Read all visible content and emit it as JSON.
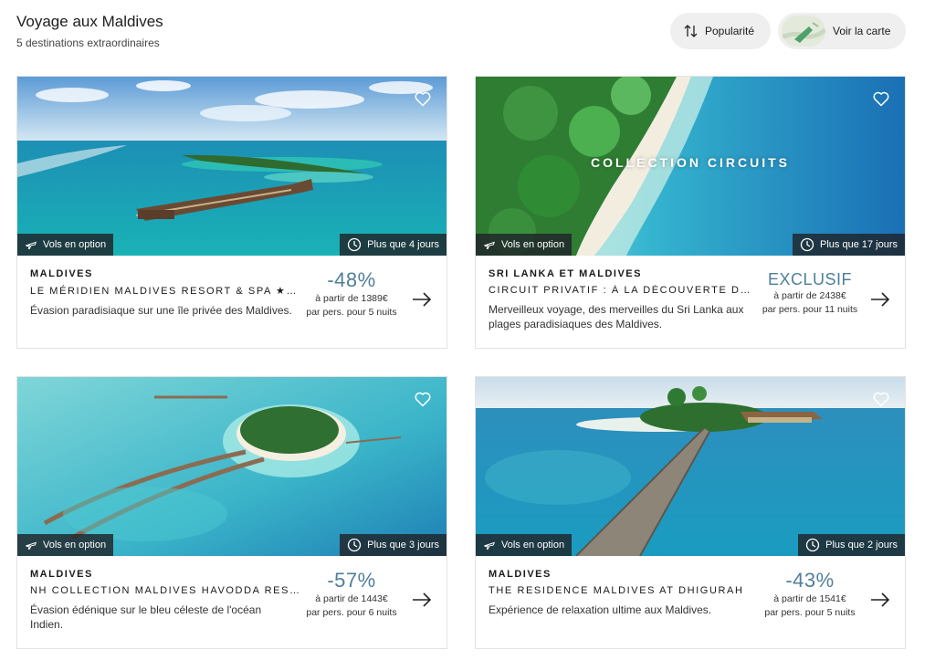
{
  "header": {
    "title": "Voyage aux Maldives",
    "subtitle": "5 destinations extraordinaires"
  },
  "toolbar": {
    "sort_label": "Popularité",
    "map_label": "Voir la carte"
  },
  "cards": [
    {
      "country": "MALDIVES",
      "hotel": "LE MÉRIDIEN MALDIVES RESORT & SPA ★★★★★",
      "description": "Évasion paradisiaque sur une île privée des Maldives.",
      "badge": "-48%",
      "price_from": "à partir de 1389€",
      "price_per": "par pers. pour 5 nuits",
      "flight_tag": "Vols en option",
      "time_tag": "Plus que 4 jours",
      "overlay": ""
    },
    {
      "country": "SRI LANKA ET MALDIVES",
      "hotel": "CIRCUIT PRIVATIF : À LA DÉCOUVERTE DU SRI LANKA",
      "description": "Merveilleux voyage, des merveilles du Sri Lanka aux plages paradisiaques des Maldives.",
      "badge": "EXCLUSIF",
      "price_from": "à partir de 2438€",
      "price_per": "par pers. pour 11 nuits",
      "flight_tag": "Vols en option",
      "time_tag": "Plus que 17 jours",
      "overlay": "COLLECTION CIRCUITS"
    },
    {
      "country": "MALDIVES",
      "hotel": "NH COLLECTION MALDIVES HAVODDA RESORT",
      "description": "Évasion édénique sur le bleu céleste de l'océan Indien.",
      "badge": "-57%",
      "price_from": "à partir de 1443€",
      "price_per": "par pers. pour 6 nuits",
      "flight_tag": "Vols en option",
      "time_tag": "Plus que 3 jours",
      "overlay": ""
    },
    {
      "country": "MALDIVES",
      "hotel": "THE RESIDENCE MALDIVES AT DHIGURAH",
      "description": "Expérience de relaxation ultime aux Maldives.",
      "badge": "-43%",
      "price_from": "à partir de 1541€",
      "price_per": "par pers. pour 5 nuits",
      "flight_tag": "Vols en option",
      "time_tag": "Plus que 2 jours",
      "overlay": ""
    }
  ],
  "colors": {
    "badge": "#4f7f99",
    "tag_background": "#1e2328",
    "button_background": "#efefef"
  },
  "icons": {
    "sort": "sort-arrows-icon",
    "heart": "heart-outline-icon",
    "plane": "plane-icon",
    "clock": "clock-icon",
    "arrow": "arrow-right-icon"
  }
}
